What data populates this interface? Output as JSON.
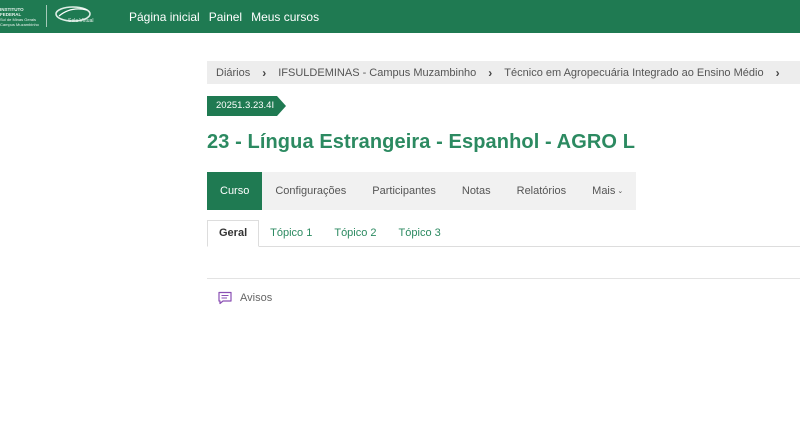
{
  "navbar": {
    "institution_logo_lines": [
      "INSTITUTO FEDERAL",
      "Sul de Minas Gerais",
      "Campus Muzambinho"
    ],
    "sala_logo_text": "Sala Virtual",
    "links": [
      {
        "label": "Página inicial"
      },
      {
        "label": "Painel"
      },
      {
        "label": "Meus cursos"
      }
    ]
  },
  "breadcrumb": {
    "items": [
      "Diários",
      "IFSULDEMINAS - Campus Muzambinho",
      "Técnico em Agropecuária Integrado ao Ensino Médio",
      ""
    ],
    "separator": "›"
  },
  "course": {
    "code": "20251.3.23.4I",
    "title": "23 - Língua Estrangeira - Espanhol - AGRO L"
  },
  "course_nav": {
    "items": [
      {
        "label": "Curso",
        "active": true
      },
      {
        "label": "Configurações"
      },
      {
        "label": "Participantes"
      },
      {
        "label": "Notas"
      },
      {
        "label": "Relatórios"
      }
    ],
    "more_label": "Mais"
  },
  "tabs": [
    {
      "label": "Geral",
      "active": true
    },
    {
      "label": "Tópico 1"
    },
    {
      "label": "Tópico 2"
    },
    {
      "label": "Tópico 3"
    }
  ],
  "activities": [
    {
      "label": "Avisos",
      "icon": "forum-icon"
    }
  ],
  "colors": {
    "brand_green": "#1f7a52",
    "title_green": "#2c8a61",
    "forum_icon_purple": "#8a4fb3"
  }
}
